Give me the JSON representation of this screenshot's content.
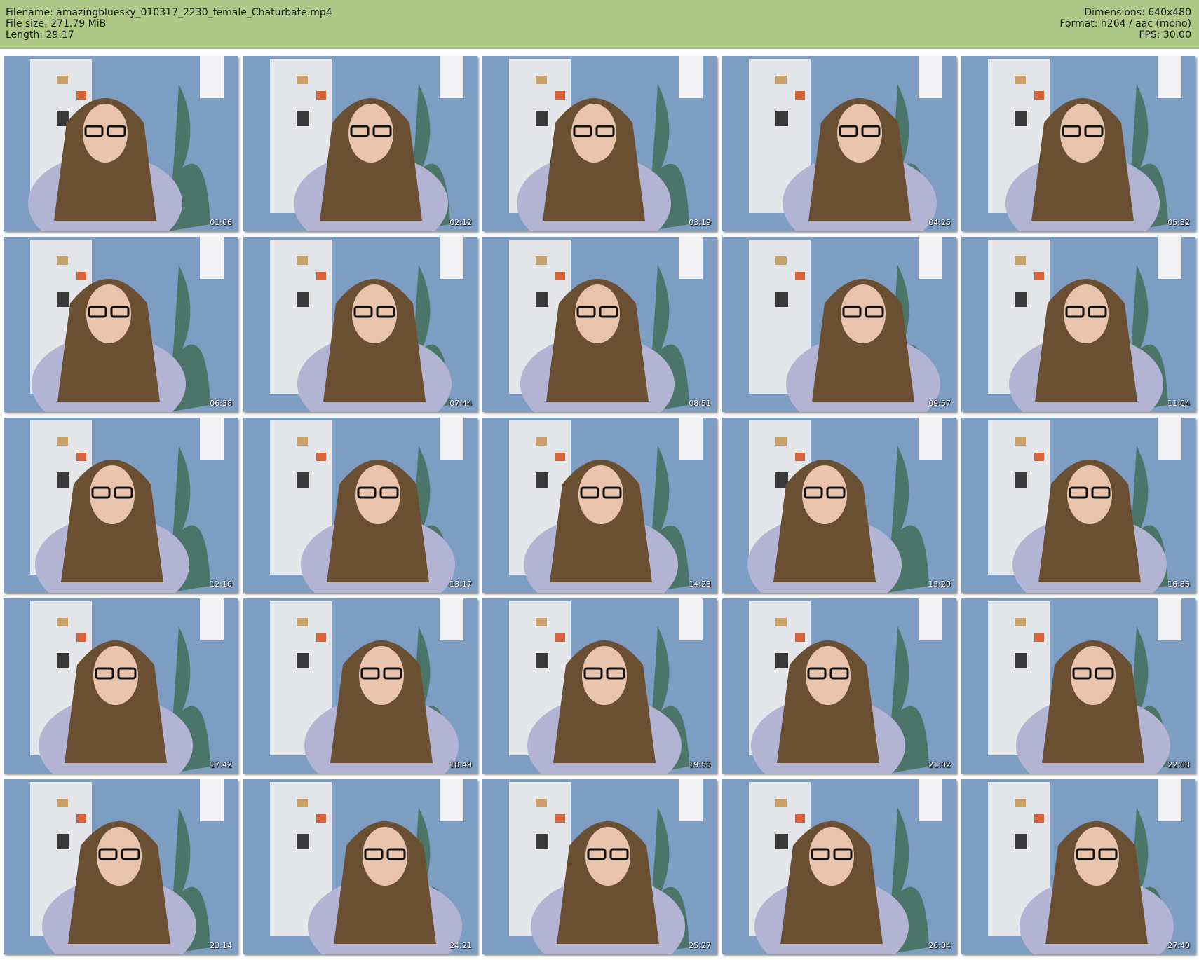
{
  "header": {
    "filename": "Filename: amazingbluesky_010317_2230_female_Chaturbate.mp4",
    "filesize": "File size: 271.79 MiB",
    "length": "Length: 29:17",
    "dimensions": "Dimensions: 640x480",
    "format": "Format: h264 / aac (mono)",
    "fps": "FPS: 30.00"
  },
  "colors": {
    "header_bg": "#aec987",
    "wall": "#7e9dc3",
    "sweater": "#b3b3d3",
    "hair": "#6b4f33"
  },
  "thumbnails": [
    {
      "time": "01:06"
    },
    {
      "time": "02:12"
    },
    {
      "time": "03:19"
    },
    {
      "time": "04:25"
    },
    {
      "time": "05:32"
    },
    {
      "time": "06:38"
    },
    {
      "time": "07:44"
    },
    {
      "time": "08:51"
    },
    {
      "time": "09:57"
    },
    {
      "time": "11:04"
    },
    {
      "time": "12:10"
    },
    {
      "time": "13:17"
    },
    {
      "time": "14:23"
    },
    {
      "time": "15:29"
    },
    {
      "time": "16:36"
    },
    {
      "time": "17:42"
    },
    {
      "time": "18:49"
    },
    {
      "time": "19:55"
    },
    {
      "time": "21:02"
    },
    {
      "time": "22:08"
    },
    {
      "time": "23:14"
    },
    {
      "time": "24:21"
    },
    {
      "time": "25:27"
    },
    {
      "time": "26:34"
    },
    {
      "time": "27:40"
    }
  ]
}
